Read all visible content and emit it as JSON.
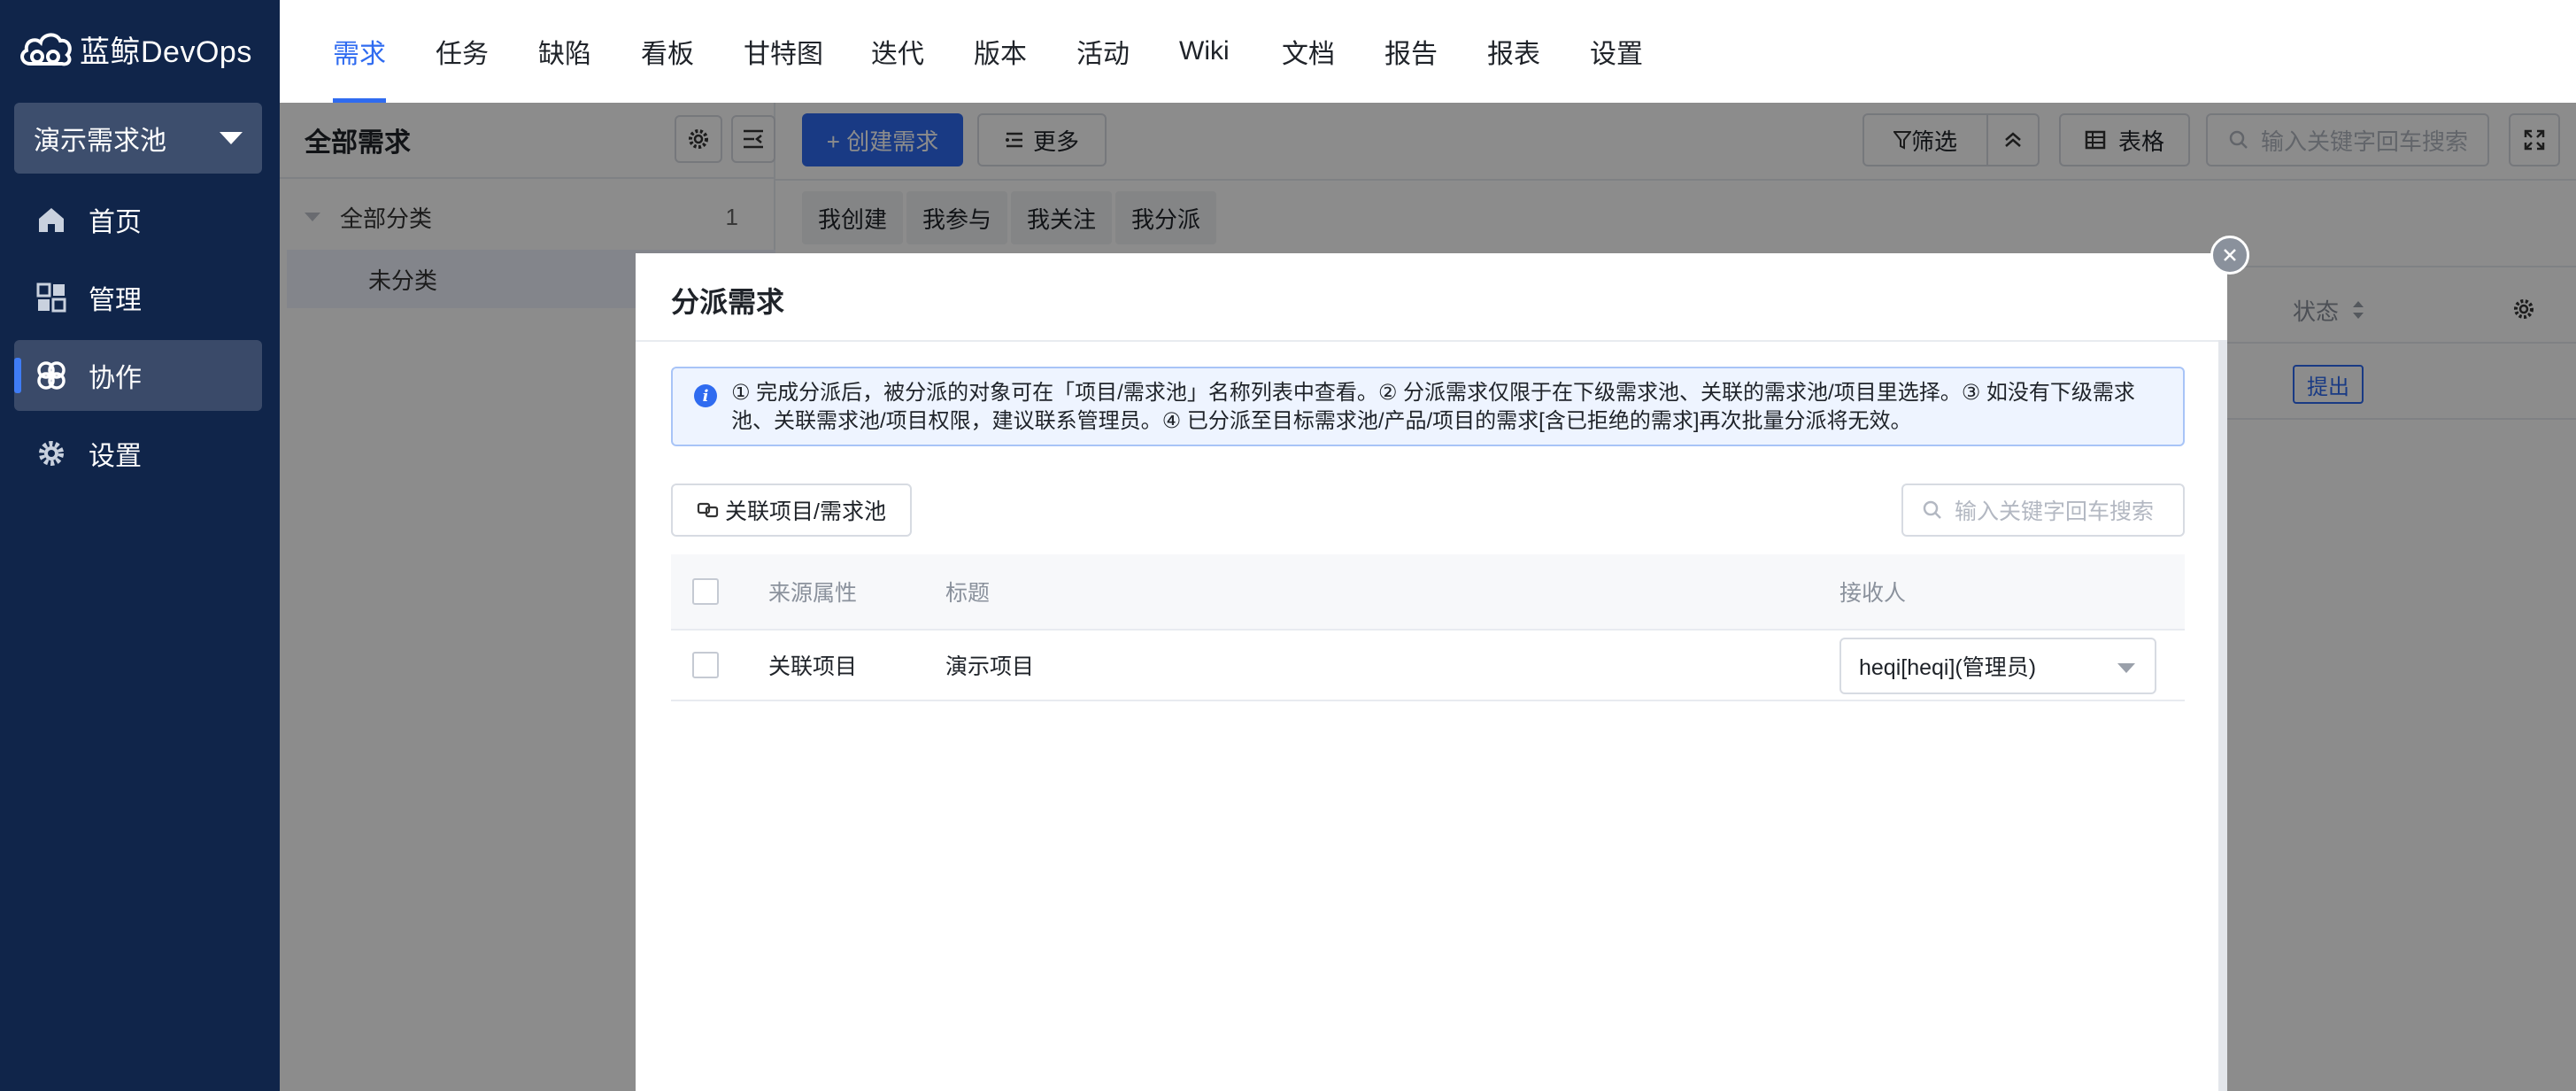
{
  "app": {
    "logo_text": "蓝鲸DevOps"
  },
  "sidebar": {
    "pool_name": "演示需求池",
    "items": [
      {
        "label": "首页",
        "icon": "home-icon"
      },
      {
        "label": "管理",
        "icon": "grid-icon"
      },
      {
        "label": "协作",
        "icon": "collab-icon",
        "active": true
      },
      {
        "label": "设置",
        "icon": "gear-icon"
      }
    ]
  },
  "topnav": {
    "tabs": [
      "需求",
      "任务",
      "缺陷",
      "看板",
      "甘特图",
      "迭代",
      "版本",
      "活动",
      "Wiki",
      "文档",
      "报告",
      "报表",
      "设置"
    ],
    "active_index": 0
  },
  "left_panel": {
    "title": "全部需求",
    "tree": {
      "root_label": "全部分类",
      "root_count": "1",
      "child_label": "未分类"
    }
  },
  "toolbar": {
    "create_label": "+ 创建需求",
    "more_label": "更多",
    "filter_label": "筛选",
    "table_label": "表格",
    "search_placeholder": "输入关键字回车搜索"
  },
  "quick_filters": [
    "我创建",
    "我参与",
    "我关注",
    "我分派"
  ],
  "list": {
    "status_header": "状态",
    "row_status": "提出"
  },
  "modal": {
    "title": "分派需求",
    "notice": "① 完成分派后，被分派的对象可在「项目/需求池」名称列表中查看。② 分派需求仅限于在下级需求池、关联的需求池/项目里选择。③ 如没有下级需求池、关联需求池/项目权限，建议联系管理员。④ 已分派至目标需求池/产品/项目的需求[含已拒绝的需求]再次批量分派将无效。",
    "link_button": "关联项目/需求池",
    "search_placeholder": "输入关键字回车搜索",
    "columns": {
      "source": "来源属性",
      "title": "标题",
      "assignee": "接收人"
    },
    "rows": [
      {
        "source": "关联项目",
        "title": "演示项目",
        "assignee": "heqi[heqi](管理员)"
      }
    ]
  },
  "colors": {
    "sidebar_bg": "#10254a",
    "accent": "#2f6bf0",
    "active_nav_bg": "#3a4a69"
  }
}
